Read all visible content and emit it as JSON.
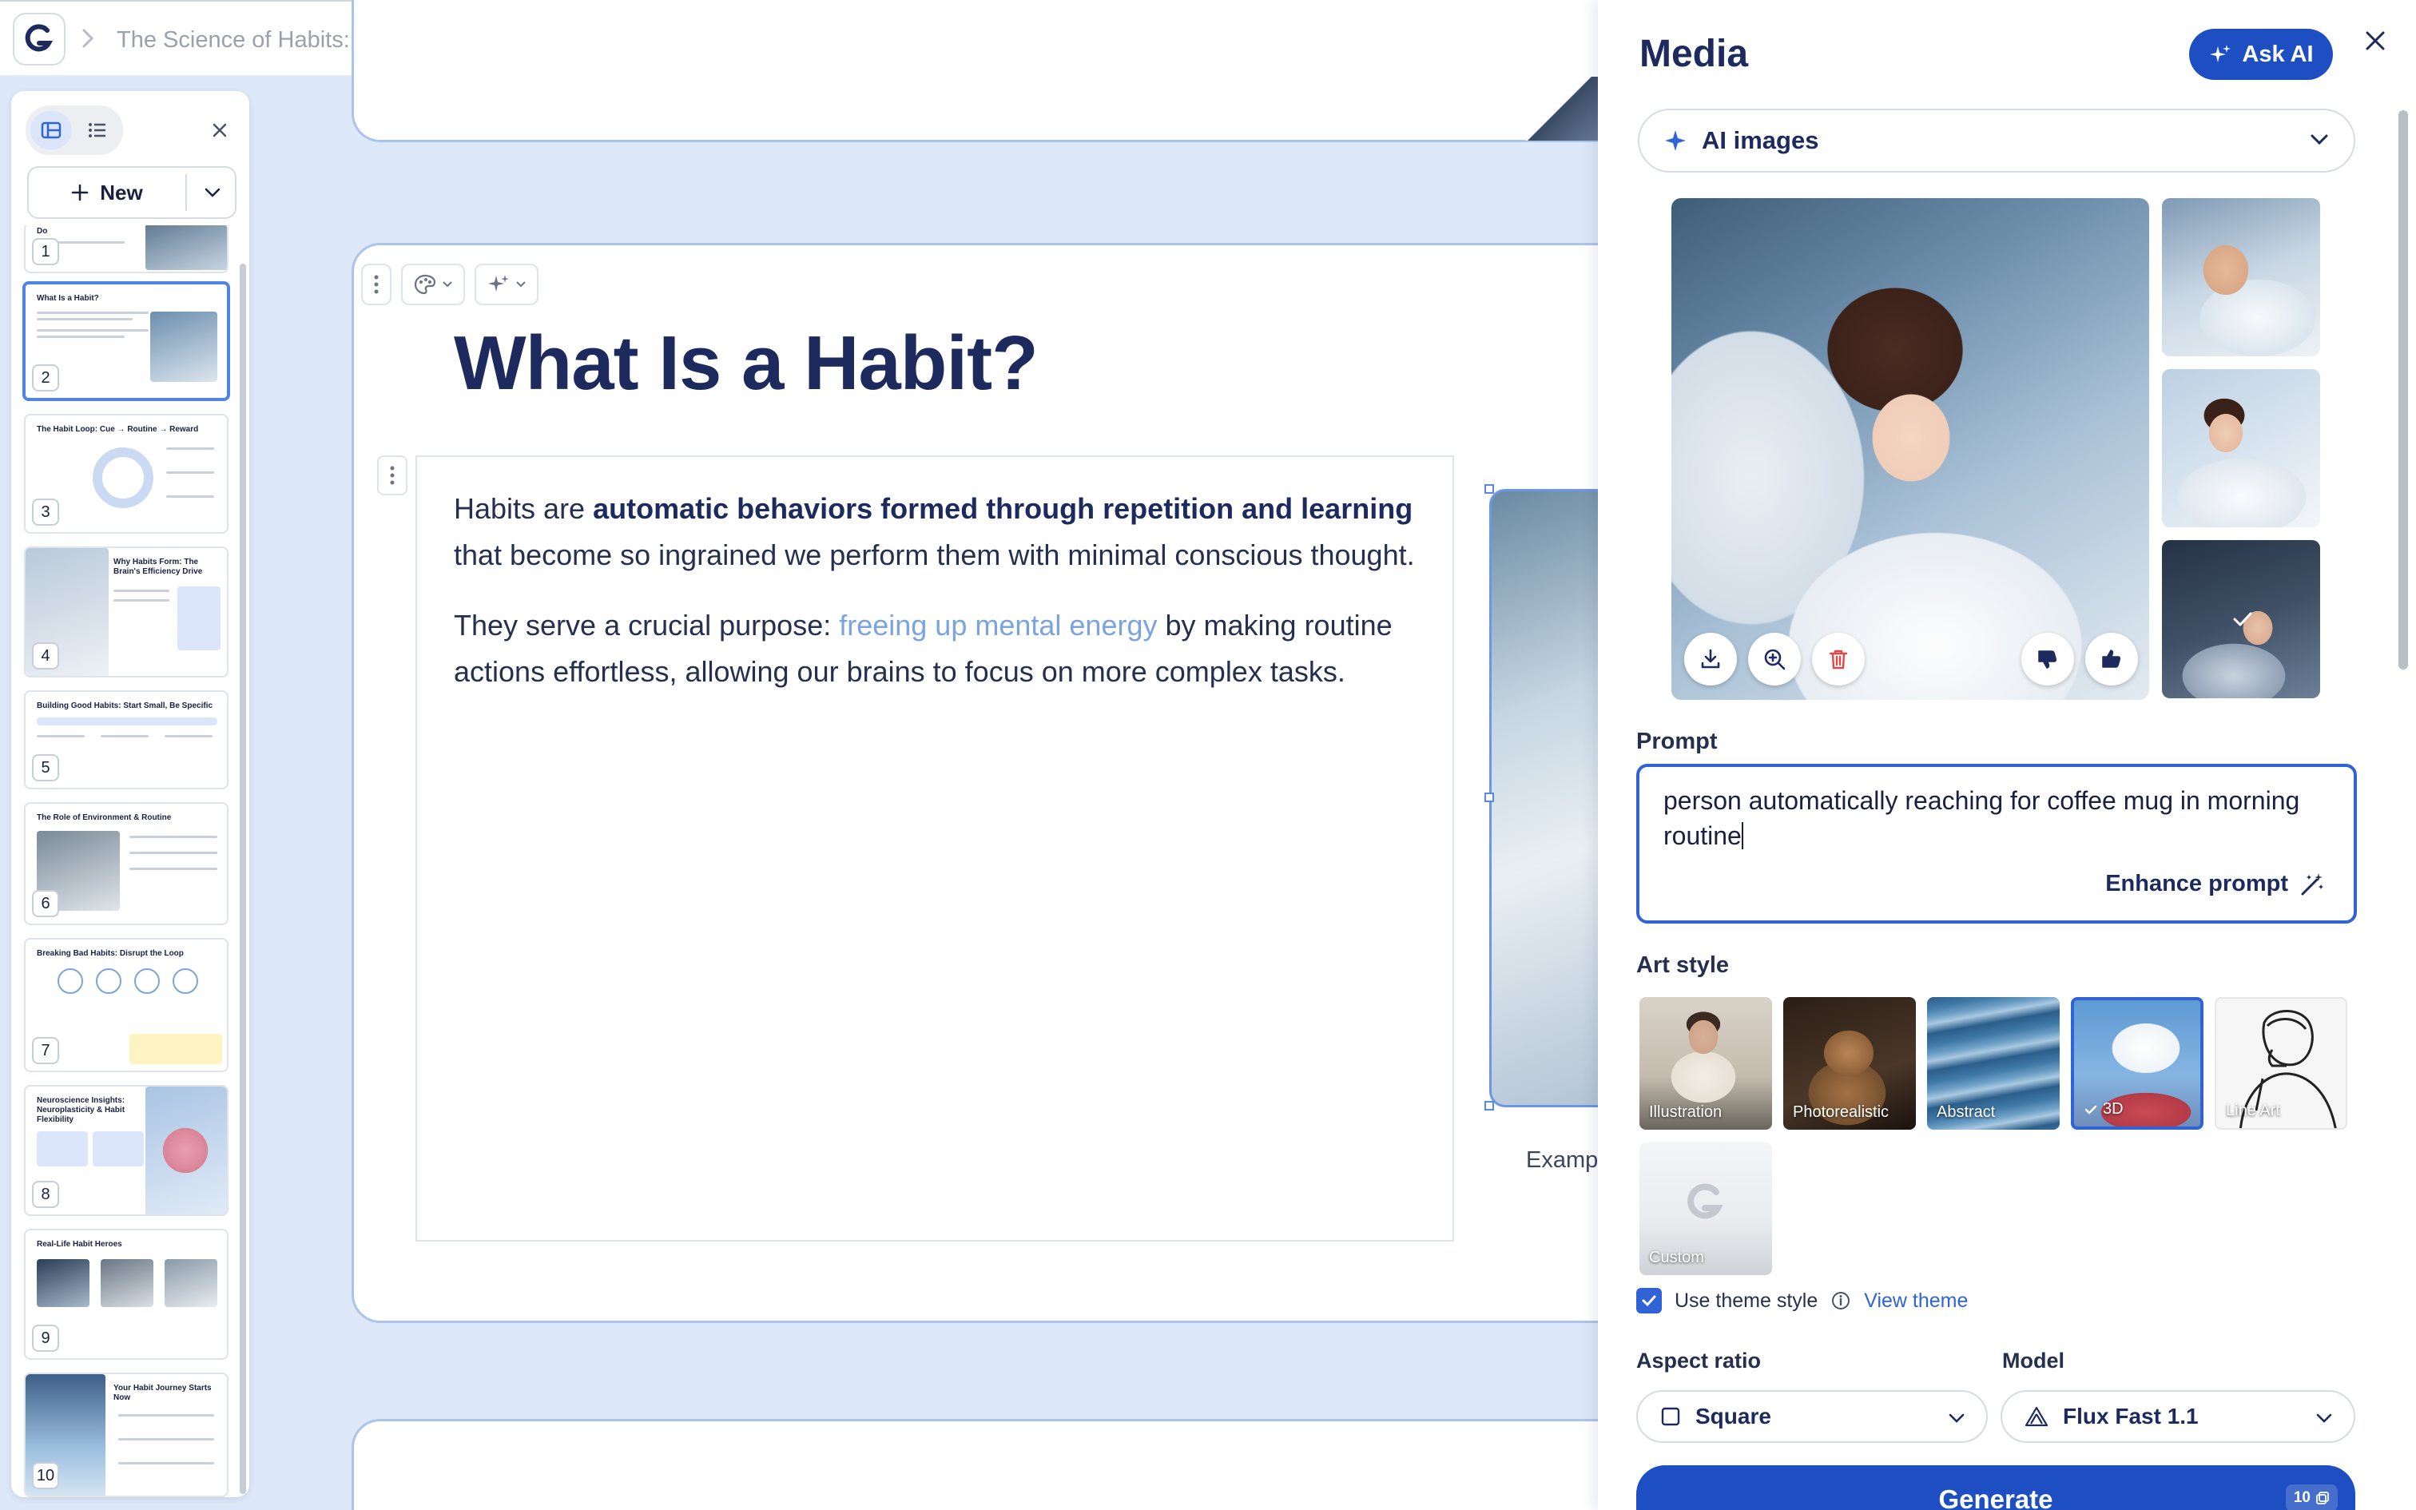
{
  "header": {
    "doc_title": "The Science of Habits: How Our Brains Shap..."
  },
  "sidebar": {
    "new_label": "New",
    "thumbnails": [
      {
        "num": "1",
        "title": "Do"
      },
      {
        "num": "2",
        "title": "What Is a Habit?"
      },
      {
        "num": "3",
        "title": "The Habit Loop: Cue → Routine → Reward"
      },
      {
        "num": "4",
        "title": "Why Habits Form: The Brain's Efficiency Drive"
      },
      {
        "num": "5",
        "title": "Building Good Habits: Start Small, Be Specific"
      },
      {
        "num": "6",
        "title": "The Role of Environment & Routine"
      },
      {
        "num": "7",
        "title": "Breaking Bad Habits: Disrupt the Loop"
      },
      {
        "num": "8",
        "title": "Neuroscience Insights: Neuroplasticity & Habit Flexibility"
      },
      {
        "num": "9",
        "title": "Real-Life Habit Heroes"
      },
      {
        "num": "10",
        "title": "Your Habit Journey Starts Now"
      }
    ]
  },
  "slide": {
    "heading": "What Is a Habit?",
    "para1_a": "Habits are ",
    "para1_bold": "automatic behaviors formed through repetition and learning",
    "para1_b": " that become so ingrained we perform them with minimal conscious thought.",
    "para2_a": "They serve a crucial purpose: ",
    "para2_highlight": "freeing up mental energy",
    "para2_b": " by making routine actions effortless, allowing our brains to focus on more complex tasks.",
    "caption": "Examp"
  },
  "media_panel": {
    "title": "Media",
    "ask_ai_label": "Ask AI",
    "source_label": "AI images",
    "prompt_label": "Prompt",
    "prompt_text": "person automatically reaching for coffee mug in morning routine",
    "enhance_label": "Enhance prompt",
    "art_style_label": "Art style",
    "art_styles": [
      {
        "label": "Illustration"
      },
      {
        "label": "Photorealistic"
      },
      {
        "label": "Abstract"
      },
      {
        "label": "3D",
        "selected": true
      },
      {
        "label": "Line Art"
      },
      {
        "label": "Custom"
      }
    ],
    "use_theme_label": "Use theme style",
    "use_theme_checked": true,
    "view_theme_label": "View theme",
    "aspect_label": "Aspect ratio",
    "aspect_value": "Square",
    "model_label": "Model",
    "model_value": "Flux Fast 1.1",
    "generate_label": "Generate",
    "credits": "10"
  },
  "colors": {
    "accent": "#1d4fc2",
    "selection": "#2f63d6",
    "canvas_bg": "#dde8f8",
    "heading": "#1c2a5e",
    "highlight_text": "#7aa3e0"
  }
}
